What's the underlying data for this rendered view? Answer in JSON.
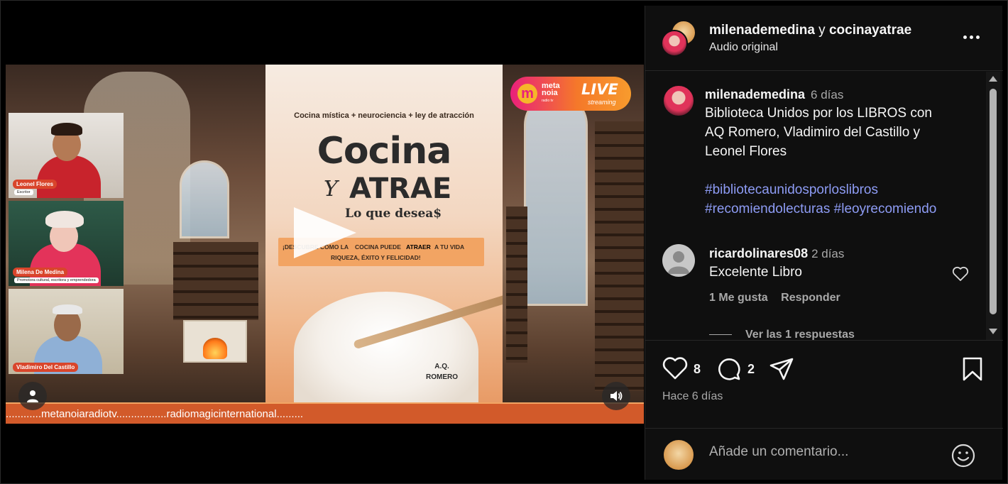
{
  "media": {
    "participants": [
      {
        "name": "Leonel Flores",
        "role": "Escritor"
      },
      {
        "name": "Milena De Medina",
        "role": "Promotora cultural, escritora y emprendedora"
      },
      {
        "name": "Vladimiro Del Castillo",
        "role": ""
      }
    ],
    "book": {
      "subtitle": "Cocina mística + neurociencia + ley de atracción",
      "title_line1": "Cocina",
      "title_y": "Y",
      "title_line2": "ATRAE",
      "tagline": "Lo que desea$",
      "banner_line1a": "¡DESCUBRE CÓMO LA ",
      "banner_line1b": "COCINA PUEDE ",
      "banner_line1c": "ATRAER",
      "banner_line1d": " A TU VIDA",
      "banner_line2": "RIQUEZA, ÉXITO Y FELICIDAD!",
      "author_line1": "A.Q.",
      "author_line2": "ROMERO"
    },
    "live_badge": {
      "logo": "m",
      "meta1": "meta",
      "meta2": "noia",
      "radio": "radio tv",
      "live": "LIVE",
      "streaming": "streaming"
    },
    "ticker": "............metanoiaradiotv.................radiomagicinternational.........",
    "icons": {
      "play": "play-icon",
      "user": "user-icon",
      "volume": "volume-icon"
    }
  },
  "header": {
    "user1": "milenademedina",
    "conj": "y",
    "user2": "cocinayatrae",
    "audio": "Audio original"
  },
  "post": {
    "author": "milenademedina",
    "time": "6 días",
    "text_line1": "Biblioteca Unidos por los LIBROS con",
    "text_line2": "AQ Romero, Vladimiro del Castillo y",
    "text_line3": "Leonel Flores",
    "tags_line1": "#bibliotecaunidosporloslibros",
    "tags_line2": "#recomiendolecturas #leoyrecomiendo"
  },
  "comments": [
    {
      "author": "ricardolinares08",
      "time": "2 días",
      "text": "Excelente Libro",
      "likes": "1 Me gusta",
      "reply": "Responder",
      "view_replies": "Ver las 1 respuestas"
    }
  ],
  "actions": {
    "likes": "8",
    "comments": "2",
    "posted": "Hace 6 días"
  },
  "compose": {
    "placeholder": "Añade un comentario..."
  },
  "colors": {
    "background": "#000000",
    "panel": "#0f0f0f",
    "hashtag": "#8e9cf5",
    "ticker": "#d25a2a"
  }
}
